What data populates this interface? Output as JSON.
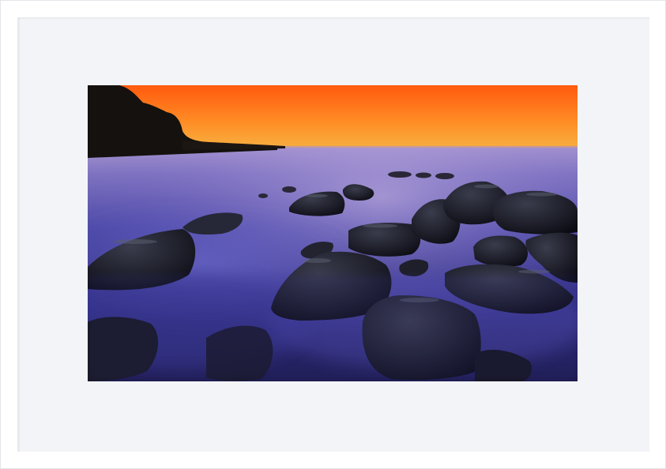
{
  "artwork": {
    "frame_color": "#ffffff",
    "mat_color": "#f3f4f8",
    "subject": "sunset-over-rocky-misty-shoreline",
    "colors": {
      "sky_top": "#ff6a14",
      "sky_horizon": "#f7a836",
      "sea_glow": "#8f7fc8",
      "mist": "#5a58c0",
      "rock": "#1a1b24"
    }
  }
}
